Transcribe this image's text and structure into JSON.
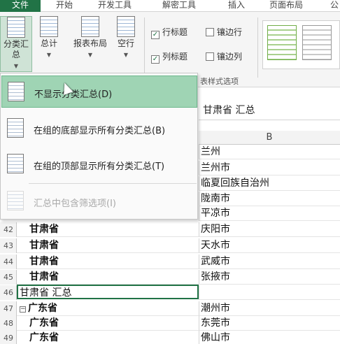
{
  "tabs": [
    "文件",
    "开始",
    "开发工具",
    "解密工具",
    "插入",
    "页面布局",
    "公"
  ],
  "ribbon": {
    "subtotal": "分类汇总",
    "grand_total": "总计",
    "report_layout": "报表布局",
    "blank_rows": "空行",
    "row_headers": "行标题",
    "column_headers": "列标题",
    "banded_rows": "镶边行",
    "banded_columns": "镶边列",
    "group_label": "表样式选项"
  },
  "menu": {
    "items": [
      "不显示分类汇总(D)",
      "在组的底部显示所有分类汇总(B)",
      "在组的顶部显示所有分类汇总(T)",
      "汇总中包含筛选项(I)"
    ]
  },
  "formula_bar": "甘肃省 汇总",
  "column_b": "B",
  "rows_top": [
    "兰州",
    "兰州市",
    "临夏回族自治州",
    "陇南市",
    "平凉市"
  ],
  "rows": [
    {
      "n": "42",
      "a": "甘肃省",
      "b": "庆阳市"
    },
    {
      "n": "43",
      "a": "甘肃省",
      "b": "天水市"
    },
    {
      "n": "44",
      "a": "甘肃省",
      "b": "武威市"
    },
    {
      "n": "45",
      "a": "甘肃省",
      "b": "张掖市"
    },
    {
      "n": "46",
      "a": "甘肃省 汇总",
      "b": ""
    },
    {
      "n": "47",
      "a": "广东省",
      "b": "潮州市"
    },
    {
      "n": "48",
      "a": "广东省",
      "b": "东莞市"
    },
    {
      "n": "49",
      "a": "广东省",
      "b": "佛山市"
    }
  ],
  "colors": {
    "accent": "#217346",
    "menu_highlight": "#9fd4b4"
  }
}
